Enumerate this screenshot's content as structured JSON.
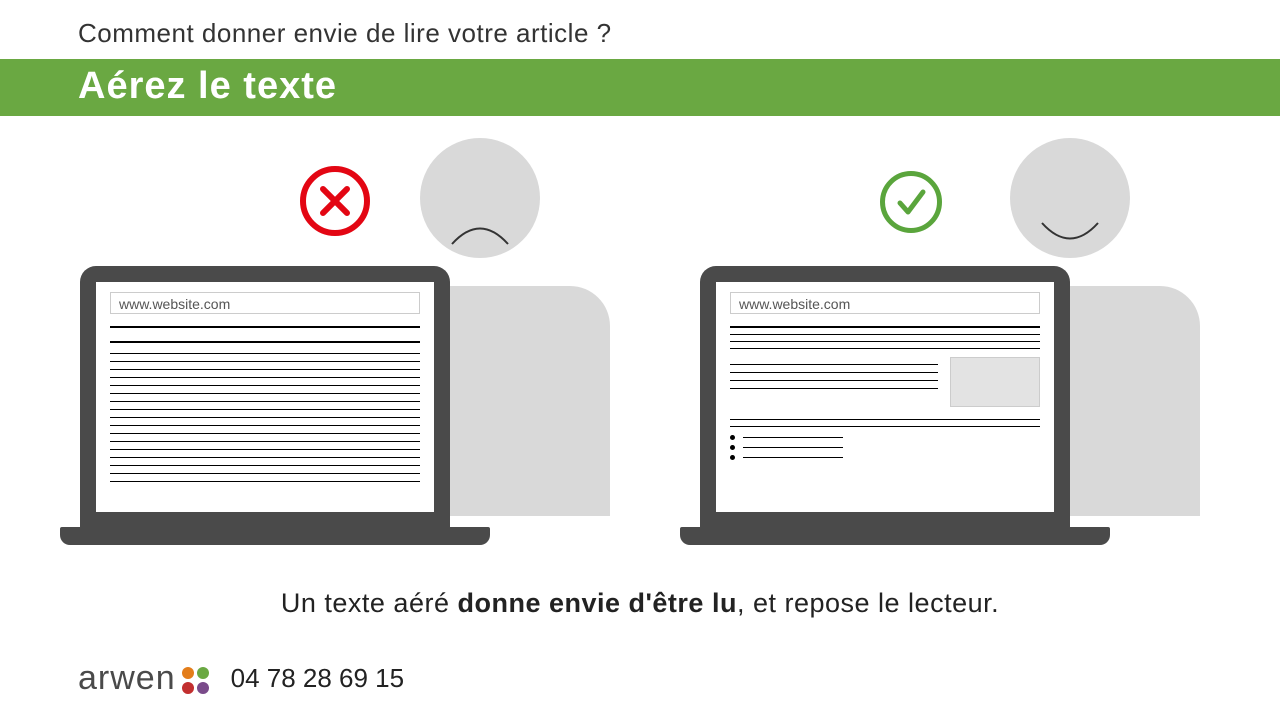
{
  "header": {
    "question": "Comment donner envie de lire votre article ?",
    "banner": "Aérez le texte"
  },
  "comparison": {
    "bad": {
      "url": "www.website.com"
    },
    "good": {
      "url": "www.website.com"
    }
  },
  "footer": {
    "sentence_pre": "Un texte aéré ",
    "sentence_bold": "donne envie d'être lu",
    "sentence_post": ", et repose le lecteur."
  },
  "brand": {
    "name": "arwen",
    "phone": "04 78 28 69 15"
  }
}
